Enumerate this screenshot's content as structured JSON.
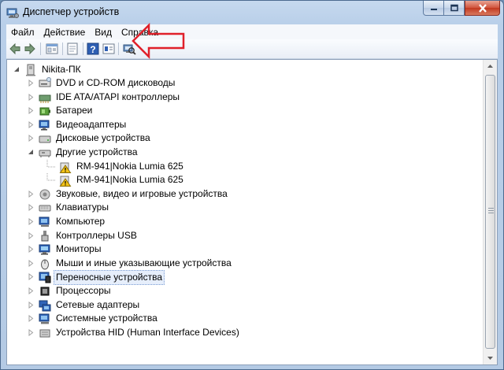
{
  "window": {
    "title": "Диспетчер устройств"
  },
  "menu": [
    {
      "label": "Файл"
    },
    {
      "label": "Действие"
    },
    {
      "label": "Вид"
    },
    {
      "label": "Справка"
    }
  ],
  "toolbar": {
    "buttons": [
      "back-icon",
      "forward-icon",
      "properties-icon",
      "show-hide-icon",
      "help-icon",
      "view-icon",
      "scan-hardware-icon"
    ]
  },
  "tree": {
    "root": "Nikita-ПК",
    "items": [
      {
        "label": "DVD и CD-ROM дисководы",
        "icon": "dvd-drive-icon"
      },
      {
        "label": "IDE ATA/ATAPI контроллеры",
        "icon": "ide-controller-icon"
      },
      {
        "label": "Батареи",
        "icon": "battery-icon"
      },
      {
        "label": "Видеоадаптеры",
        "icon": "display-adapter-icon"
      },
      {
        "label": "Дисковые устройства",
        "icon": "disk-drive-icon"
      },
      {
        "label": "Другие устройства",
        "icon": "other-devices-icon",
        "expanded": true,
        "children": [
          {
            "label": "RM-941|Nokia Lumia 625",
            "icon": "unknown-device-warning-icon"
          },
          {
            "label": "RM-941|Nokia Lumia 625",
            "icon": "unknown-device-warning-icon"
          }
        ]
      },
      {
        "label": "Звуковые, видео и игровые устройства",
        "icon": "sound-icon"
      },
      {
        "label": "Клавиатуры",
        "icon": "keyboard-icon"
      },
      {
        "label": "Компьютер",
        "icon": "computer-icon"
      },
      {
        "label": "Контроллеры USB",
        "icon": "usb-icon"
      },
      {
        "label": "Мониторы",
        "icon": "monitor-icon"
      },
      {
        "label": "Мыши и иные указывающие устройства",
        "icon": "mouse-icon"
      },
      {
        "label": "Переносные устройства",
        "icon": "portable-device-icon",
        "selected": true
      },
      {
        "label": "Процессоры",
        "icon": "processor-icon"
      },
      {
        "label": "Сетевые адаптеры",
        "icon": "network-adapter-icon"
      },
      {
        "label": "Системные устройства",
        "icon": "system-device-icon"
      },
      {
        "label": "Устройства HID (Human Interface Devices)",
        "icon": "hid-icon"
      }
    ]
  },
  "annotation": {
    "color": "#e0202a"
  }
}
